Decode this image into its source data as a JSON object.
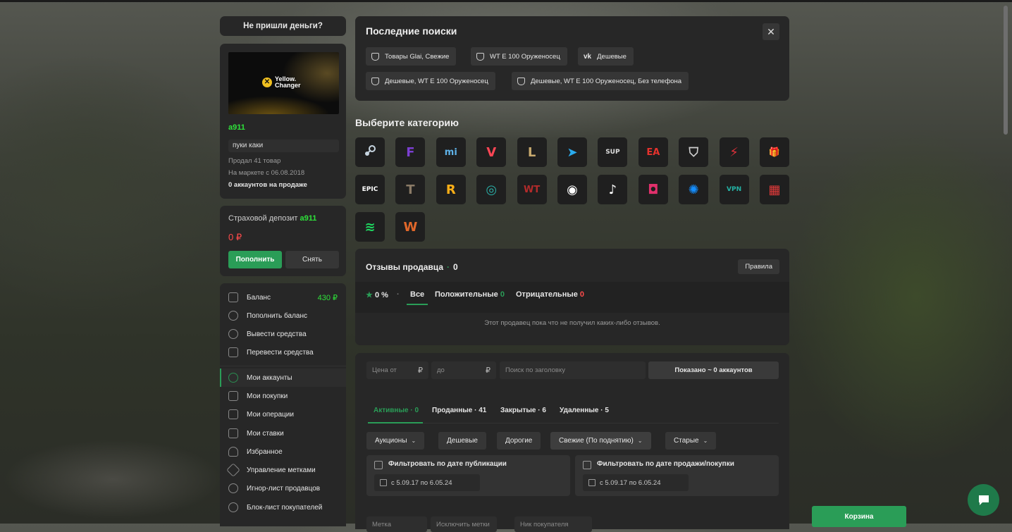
{
  "left": {
    "no_money_button": "Не пришли деньги?",
    "profile": {
      "banner_logo_line1": "Yellow.",
      "banner_logo_line2": "Changer",
      "username": "a911",
      "status": "пуки каки",
      "sold": "Продал 41 товар",
      "since": "На маркете с 06.08.2018",
      "accounts_on_sale": "0 аккаунтов на продаже"
    },
    "deposit": {
      "label": "Страховой депозит",
      "user": "a911",
      "amount": "0 ₽",
      "topup_button": "Пополнить",
      "withdraw_button": "Снять"
    },
    "menu": [
      {
        "label": "Баланс",
        "value": "430 ₽",
        "icon": "wallet-icon"
      },
      {
        "label": "Пополнить баланс",
        "icon": "plus-circle-icon"
      },
      {
        "label": "Вывести средства",
        "icon": "upload-icon"
      },
      {
        "label": "Перевести средства",
        "icon": "send-icon"
      },
      {
        "label": "Мои аккаунты",
        "icon": "key-icon",
        "active": true
      },
      {
        "label": "Мои покупки",
        "icon": "bag-icon"
      },
      {
        "label": "Мои операции",
        "icon": "list-icon"
      },
      {
        "label": "Мои ставки",
        "icon": "gavel-icon"
      },
      {
        "label": "Избранное",
        "icon": "heart-icon"
      },
      {
        "label": "Управление метками",
        "icon": "tag-icon"
      },
      {
        "label": "Игнор-лист продавцов",
        "icon": "user-x-icon"
      },
      {
        "label": "Блок-лист покупателей",
        "icon": "user-block-icon"
      }
    ]
  },
  "recent": {
    "title": "Последние поиски",
    "close": "✕",
    "chips": [
      "Товары Glai, Свежие",
      "WT E 100 Оруженосец",
      "Дешевые",
      "Дешевые, WT E 100 Оруженосец",
      "Дешевые, WT E 100 Оруженосец, Без телефона"
    ]
  },
  "categories": {
    "title": "Выберите категорию",
    "items": [
      {
        "name": "steam",
        "icon": "steam-icon",
        "color": "#c7d5e0"
      },
      {
        "name": "fortnite",
        "icon": "fortnite-icon",
        "color": "#7b3fd1",
        "glyph": "F"
      },
      {
        "name": "mihoyo",
        "icon": "mihoyo-icon",
        "color": "#5fb2e8",
        "glyph": "mi"
      },
      {
        "name": "valorant",
        "icon": "valorant-icon",
        "color": "#ff4655",
        "glyph": "V"
      },
      {
        "name": "league-of-legends",
        "icon": "lol-icon",
        "color": "#c8aa6e",
        "glyph": "L"
      },
      {
        "name": "telegram",
        "icon": "telegram-icon",
        "color": "#2aabee",
        "glyph": "➤"
      },
      {
        "name": "supercell",
        "icon": "supercell-icon",
        "color": "#dddddd",
        "glyph": "SUP"
      },
      {
        "name": "ea",
        "icon": "ea-icon",
        "color": "#e5322d",
        "glyph": "EA"
      },
      {
        "name": "world-of-tanks",
        "icon": "wot-icon",
        "color": "#cfcfcf",
        "glyph": "⛉"
      },
      {
        "name": "wot-blitz",
        "icon": "blitz-icon",
        "color": "#e0303a",
        "glyph": "⚡"
      },
      {
        "name": "gifts",
        "icon": "gift-icon",
        "color": "#3fb45a",
        "glyph": "🎁"
      },
      {
        "name": "epic-games",
        "icon": "epic-icon",
        "color": "#ffffff",
        "glyph": "EPIC"
      },
      {
        "name": "escape-from-tarkov",
        "icon": "tarkov-icon",
        "color": "#8a7a66",
        "glyph": "T"
      },
      {
        "name": "rockstar",
        "icon": "rockstar-icon",
        "color": "#fcaf17",
        "glyph": "R"
      },
      {
        "name": "uplay",
        "icon": "uplay-icon",
        "color": "#2ab0a8",
        "glyph": "◎"
      },
      {
        "name": "war-thunder",
        "icon": "warthunder-icon",
        "color": "#b32b2b",
        "glyph": "WT"
      },
      {
        "name": "discord",
        "icon": "discord-icon",
        "color": "#ffffff",
        "glyph": "◉"
      },
      {
        "name": "tiktok",
        "icon": "tiktok-icon",
        "color": "#ffffff",
        "glyph": "♪"
      },
      {
        "name": "instagram",
        "icon": "instagram-icon",
        "color": "#e1306c",
        "glyph": "◘"
      },
      {
        "name": "battlenet",
        "icon": "battlenet-icon",
        "color": "#148eff",
        "glyph": "✺"
      },
      {
        "name": "vpn",
        "icon": "vpn-icon",
        "color": "#24b3a6",
        "glyph": "VPN"
      },
      {
        "name": "cinema",
        "icon": "film-icon",
        "color": "#e03a3a",
        "glyph": "▦"
      },
      {
        "name": "spotify",
        "icon": "spotify-icon",
        "color": "#1ed760",
        "glyph": "≋"
      },
      {
        "name": "warface",
        "icon": "warface-icon",
        "color": "#e0672a",
        "glyph": "W"
      }
    ]
  },
  "reviews": {
    "title": "Отзывы продавца",
    "count": "0",
    "rules_button": "Правила",
    "percent": "0 %",
    "tab_all": "Все",
    "tab_positive": "Положительные",
    "positive_count": "0",
    "tab_negative": "Отрицательные",
    "negative_count": "0",
    "empty": "Этот продавец пока что не получил каких-либо отзывов."
  },
  "filters": {
    "price_from": "Цена от",
    "price_to": "до",
    "currency": "₽",
    "search_placeholder": "Поиск по заголовку",
    "shown": "Показано ~ 0 аккаунтов",
    "tabs": [
      "Активные · 0",
      "Проданные · 41",
      "Закрытые · 6",
      "Удаленные · 5"
    ],
    "sort": [
      "Аукционы",
      "Дешевые",
      "Дорогие",
      "Свежие (По поднятию)",
      "Старые"
    ],
    "date_pub_label": "Фильтровать по дате публикации",
    "date_pub_range": "с 5.09.17 по 6.05.24",
    "date_sale_label": "Фильтровать по дате продажи/покупки",
    "date_sale_range": "с 5.09.17 по 6.05.24",
    "bottom_inputs": [
      "Метка",
      "Исключить метки",
      "Ник покупателя"
    ]
  },
  "cart_button": "Корзина",
  "colors": {
    "accent": "#2a9d57",
    "username": "#2ee23a",
    "danger": "#ff4b4b"
  }
}
